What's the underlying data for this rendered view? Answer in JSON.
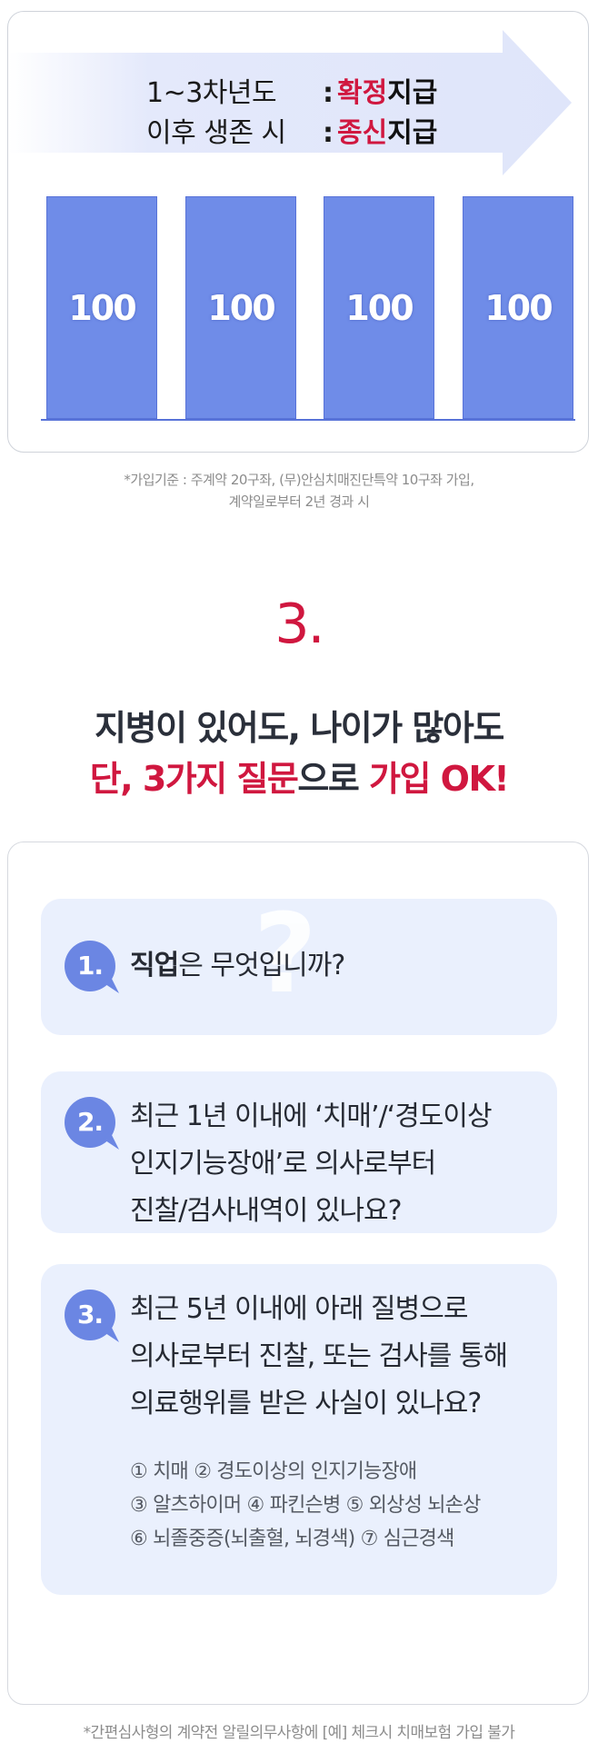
{
  "chart": {
    "arrow_rows": [
      {
        "label": "1~3차년도",
        "colon": ":",
        "highlight": "확정",
        "suffix": "지급"
      },
      {
        "label": "이후 생존 시",
        "colon": ":",
        "highlight": "종신",
        "suffix": "지급"
      }
    ],
    "note_lines": [
      "*가입기준 : 주계약 20구좌, (무)안심치매진단특약 10구좌 가입,",
      "계약일로부터 2년 경과 시"
    ]
  },
  "chart_data": {
    "type": "bar",
    "categories": [
      "",
      "",
      "",
      ""
    ],
    "values": [
      100,
      100,
      100,
      100
    ],
    "value_labels": [
      "100",
      "100",
      "100",
      "100"
    ],
    "ylim": [
      0,
      100
    ],
    "grid": false,
    "bar_color": "#6f8ce8"
  },
  "section": {
    "number": "3.",
    "line1": "지병이 있어도, 나이가 많아도",
    "line2_red1": "단, 3가지 질문",
    "line2_dark": "으로 ",
    "line2_red2": "가입 OK!"
  },
  "questions": [
    {
      "badge": "1.",
      "lines": [
        {
          "bold": "직업",
          "text": "은 무엇입니까?"
        }
      ],
      "watermark": "?"
    },
    {
      "badge": "2.",
      "lines": [
        {
          "text": "최근 1년 이내에 ‘치매’/‘경도이상"
        },
        {
          "text": "인지기능장애’로 의사로부터"
        },
        {
          "text": "진찰/검사내역이 있나요?"
        }
      ]
    },
    {
      "badge": "3.",
      "lines": [
        {
          "text": "최근 5년 이내에 아래 질병으로"
        },
        {
          "text": "의사로부터 진찰, 또는 검사를 통해"
        },
        {
          "text": "의료행위를 받은 사실이 있나요?"
        }
      ],
      "list": [
        "① 치매  ② 경도이상의 인지기능장애",
        "③ 알츠하이머  ④ 파킨슨병  ⑤ 외상성 뇌손상",
        "⑥ 뇌졸중증(뇌출혈, 뇌경색) ⑦ 심근경색"
      ]
    }
  ],
  "bottom_note": "*간편심사형의 계약전 알릴의무사항에 [예] 체크시 치매보험 가입 불가",
  "colors": {
    "accent_red": "#d0173f",
    "bar_blue": "#6f8ce8",
    "badge_blue": "#6b86e3",
    "question_bg": "#eaf0fd"
  }
}
